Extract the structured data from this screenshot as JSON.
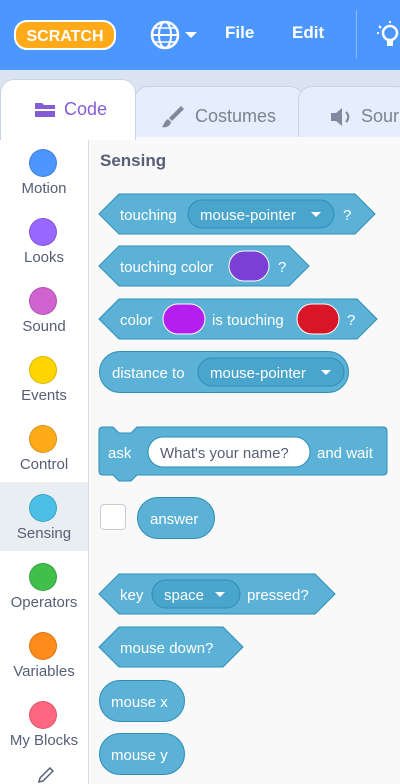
{
  "app": {
    "logo_text": "SCRATCH"
  },
  "menubar": {
    "file_label": "File",
    "edit_label": "Edit"
  },
  "tabs": [
    {
      "label": "Code",
      "active": true
    },
    {
      "label": "Costumes",
      "active": false
    },
    {
      "label": "Sour",
      "active": false
    }
  ],
  "categories": [
    {
      "name": "Motion",
      "color": "#4c97ff"
    },
    {
      "name": "Looks",
      "color": "#9966ff"
    },
    {
      "name": "Sound",
      "color": "#cf63cf"
    },
    {
      "name": "Events",
      "color": "#ffd500"
    },
    {
      "name": "Control",
      "color": "#ffab19"
    },
    {
      "name": "Sensing",
      "color": "#4cbfe6",
      "selected": true
    },
    {
      "name": "Operators",
      "color": "#40bf4a"
    },
    {
      "name": "Variables",
      "color": "#ff8c1a"
    },
    {
      "name": "My Blocks",
      "color": "#ff6680"
    }
  ],
  "palette": {
    "title": "Sensing",
    "block_color": "#5cb1d6",
    "blocks": {
      "touching": {
        "prefix": "touching",
        "dropdown": "mouse-pointer",
        "suffix": "?"
      },
      "touching_color": {
        "prefix": "touching color",
        "swatch": "#7c3fd6",
        "suffix": "?"
      },
      "color_touching": {
        "prefix": "color",
        "swatch1": "#b41ff0",
        "middle": "is touching",
        "swatch2": "#d91528",
        "suffix": "?"
      },
      "distance_to": {
        "prefix": "distance to",
        "dropdown": "mouse-pointer"
      },
      "ask": {
        "prefix": "ask",
        "input": "What's your name?",
        "suffix": "and wait"
      },
      "answer": {
        "label": "answer"
      },
      "key_pressed": {
        "prefix": "key",
        "dropdown": "space",
        "suffix": "pressed?"
      },
      "mouse_down": {
        "label": "mouse down?"
      },
      "mouse_x": {
        "label": "mouse x"
      },
      "mouse_y": {
        "label": "mouse y"
      }
    }
  }
}
